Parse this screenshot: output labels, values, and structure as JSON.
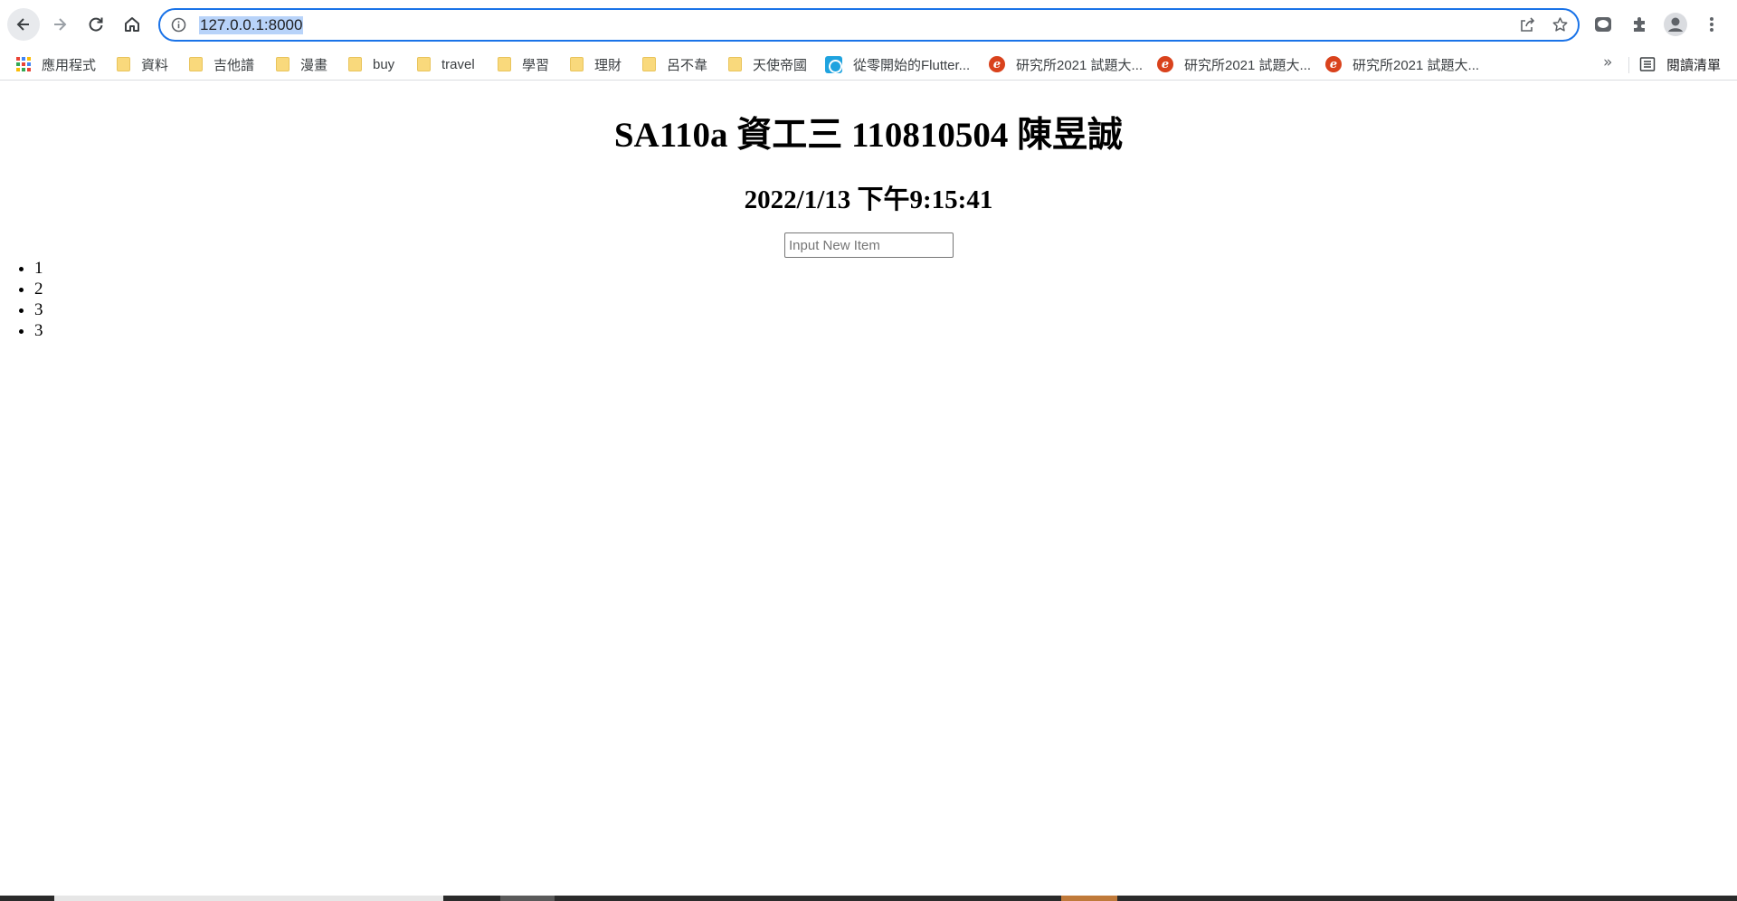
{
  "browser": {
    "url": "127.0.0.1:8000",
    "bookmarks": [
      {
        "label": "應用程式",
        "icon": "apps-icon"
      },
      {
        "label": "資料",
        "icon": "folder-icon"
      },
      {
        "label": "吉他譜",
        "icon": "folder-icon"
      },
      {
        "label": "漫畫",
        "icon": "folder-icon"
      },
      {
        "label": "buy",
        "icon": "folder-icon"
      },
      {
        "label": "travel",
        "icon": "folder-icon"
      },
      {
        "label": "學習",
        "icon": "folder-icon"
      },
      {
        "label": "理財",
        "icon": "folder-icon"
      },
      {
        "label": "呂不韋",
        "icon": "folder-icon"
      },
      {
        "label": "天使帝國",
        "icon": "folder-icon"
      },
      {
        "label": "從零開始的Flutter...",
        "icon": "flutter-site-icon"
      },
      {
        "label": "研究所2021 試題大...",
        "icon": "exam-site-icon"
      },
      {
        "label": "研究所2021 試題大...",
        "icon": "exam-site-icon"
      },
      {
        "label": "研究所2021 試題大...",
        "icon": "exam-site-icon"
      }
    ],
    "more_bookmarks": "»",
    "reading_list": "閱讀清單",
    "accent_color": "#1a73e8"
  },
  "page": {
    "title": "SA110a 資工三 110810504 陳昱誠",
    "clock": "2022/1/13 下午9:15:41",
    "input_placeholder": "Input New Item",
    "items": [
      "1",
      "2",
      "3",
      "3"
    ]
  }
}
